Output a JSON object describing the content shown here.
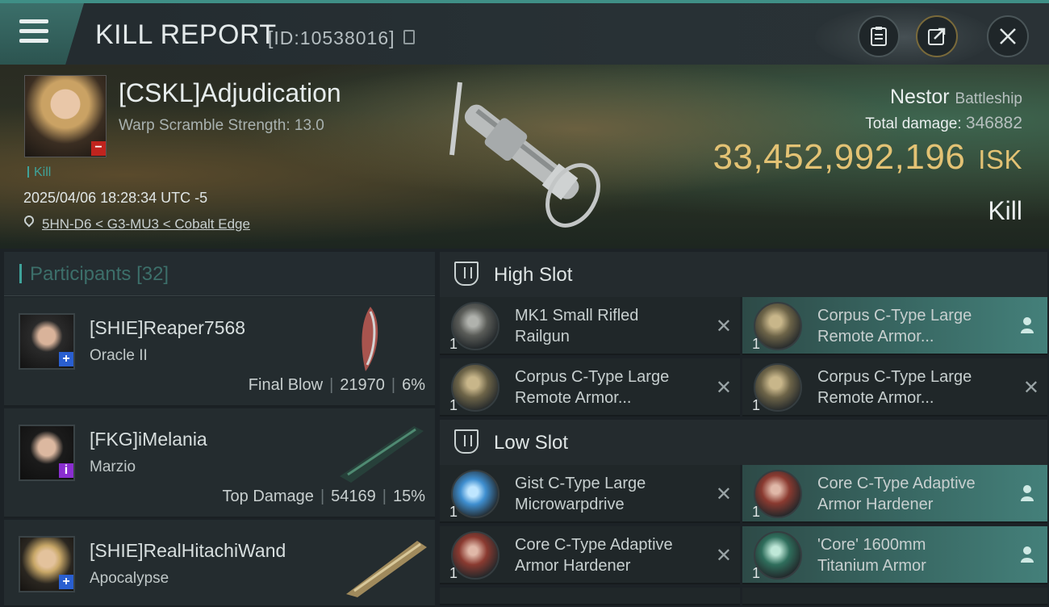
{
  "header": {
    "title": "KILL REPORT",
    "report_id": "[ID:10538016]",
    "icons": [
      "menu-icon",
      "copy-icon",
      "clipboard-icon",
      "share-icon",
      "close-icon"
    ]
  },
  "victim": {
    "name": "[CSKL]Adjudication",
    "warp_scramble": "Warp Scramble Strength: 13.0",
    "kill_tag": "Kill",
    "datetime": "2025/04/06 18:28:34 UTC -5",
    "location": "5HN-D6 < G3-MU3 < Cobalt Edge",
    "ship_name": "Nestor",
    "ship_class": "Battleship",
    "total_damage_label": "Total damage:",
    "total_damage": "346882",
    "isk_value": "33,452,992,196",
    "isk_unit": "ISK",
    "result": "Kill"
  },
  "participants": {
    "label": "Participants",
    "count": "[32]",
    "rows": [
      {
        "name": "[SHIE]Reaper7568",
        "ship": "Oracle II",
        "role": "Final Blow",
        "damage": "21970",
        "percent": "6%",
        "badge": "+",
        "badge_color": "#2a5fd0"
      },
      {
        "name": "[FKG]iMelania",
        "ship": "Marzio",
        "role": "Top Damage",
        "damage": "54169",
        "percent": "15%",
        "badge": "i",
        "badge_color": "#8a2ed0"
      },
      {
        "name": "[SHIE]RealHitachiWand",
        "ship": "Apocalypse",
        "role": "",
        "damage": "",
        "percent": "",
        "badge": "+",
        "badge_color": "#2a5fd0"
      }
    ]
  },
  "high_slot": {
    "title": "High Slot",
    "items": [
      {
        "line1": "MK1 Small Rifled",
        "line2": "Railgun",
        "qty": "1",
        "action": "✕"
      },
      {
        "line1": "Corpus C-Type Large",
        "line2": "Remote Armor...",
        "qty": "1",
        "action": "user"
      },
      {
        "line1": "Corpus C-Type Large",
        "line2": "Remote Armor...",
        "qty": "1",
        "action": "✕"
      },
      {
        "line1": "Corpus C-Type Large",
        "line2": "Remote Armor...",
        "qty": "1",
        "action": "✕"
      }
    ]
  },
  "low_slot": {
    "title": "Low Slot",
    "items": [
      {
        "line1": "Gist C-Type Large",
        "line2": "Microwarpdrive",
        "qty": "1",
        "action": "✕"
      },
      {
        "line1": "Core C-Type Adaptive",
        "line2": "Armor Hardener",
        "qty": "1",
        "action": "user"
      },
      {
        "line1": "Core C-Type Adaptive",
        "line2": "Armor Hardener",
        "qty": "1",
        "action": "✕"
      },
      {
        "line1": "'Core' 1600mm",
        "line2": "Titanium Armor",
        "qty": "1",
        "action": "user"
      }
    ]
  },
  "colors": {
    "accent": "#3fa39a",
    "isk": "#e3c274",
    "highlight": "#3a6b66"
  }
}
